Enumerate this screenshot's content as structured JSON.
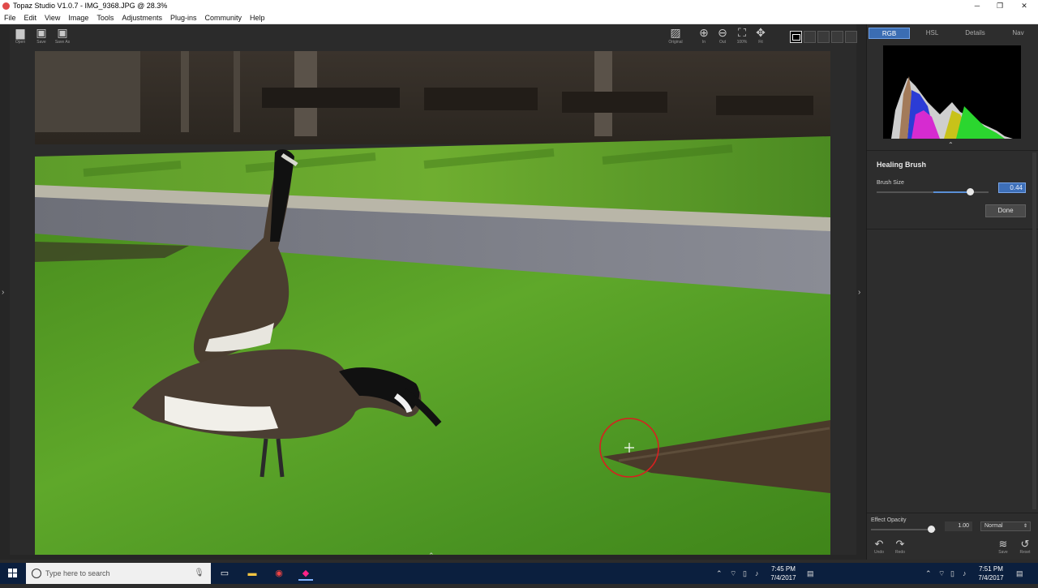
{
  "window": {
    "title": "Topaz Studio V1.0.7 - IMG_9368.JPG @ 28.3%",
    "minimize": "─",
    "maximize": "❐",
    "close": "✕"
  },
  "menu": [
    "File",
    "Edit",
    "View",
    "Image",
    "Tools",
    "Adjustments",
    "Plug-ins",
    "Community",
    "Help"
  ],
  "toolbar": {
    "open": "Open",
    "save": "Save",
    "save_as": "Save As",
    "original": "Original",
    "zoom_in": "In",
    "zoom_out": "Out",
    "zoom_100": "100%",
    "fit": "Fit"
  },
  "panel": {
    "tabs": [
      "RGB",
      "HSL",
      "Details",
      "Nav"
    ],
    "active_tab": "RGB",
    "tool_title": "Healing Brush",
    "brush_size_label": "Brush Size",
    "brush_size_value": "0.44",
    "done_label": "Done",
    "effect_opacity_label": "Effect Opacity",
    "effect_opacity_value": "1.00",
    "blend_mode": "Normal",
    "undo": "Undo",
    "redo": "Redo",
    "save": "Save",
    "reset": "Reset",
    "accent_color": "#3b6db3"
  },
  "taskbar": {
    "search_placeholder": "Type here to search",
    "time_left": "7:45 PM",
    "date_left": "7/4/2017",
    "time_right": "7:51 PM",
    "date_right": "7/4/2017"
  }
}
